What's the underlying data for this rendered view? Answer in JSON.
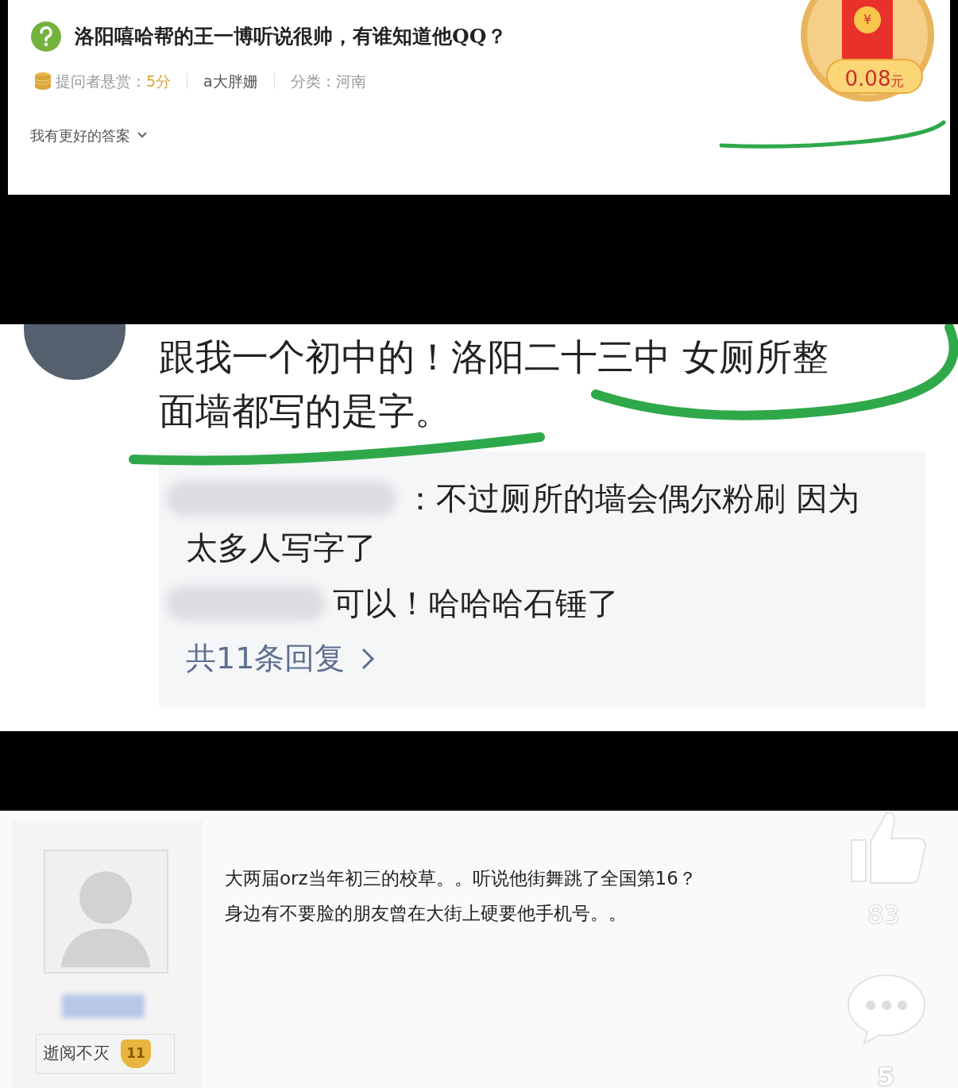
{
  "question": {
    "title": "洛阳嘻哈帮的王一博听说很帅，有谁知道他QQ？",
    "reward_label": "提问者悬赏：",
    "reward_value": "5分",
    "asker": "a大胖姗",
    "category": "分类：河南",
    "better_answer": "我有更好的答案"
  },
  "red_packet": {
    "symbol": "¥",
    "amount": "0.08",
    "unit": "元"
  },
  "comment": {
    "lines": [
      "跟我一个初中的！洛阳二十三中 女厕所整",
      "面墙都写的是字。"
    ],
    "replies": [
      {
        "lines": [
          "：不过厕所的墙会偶尔粉刷 因为",
          "太多人写字了"
        ]
      },
      {
        "lines": [
          "可以！哈哈哈石锤了"
        ]
      }
    ],
    "more": "共11条回复"
  },
  "answer": {
    "lines": [
      "大两届orz当年初三的校草。。听说他街舞跳了全国第16？",
      "身边有不要脸的朋友曾在大街上硬要他手机号。。"
    ],
    "user_title": "逝阅不灭",
    "level": "11",
    "likes": "83",
    "comments": "5"
  }
}
